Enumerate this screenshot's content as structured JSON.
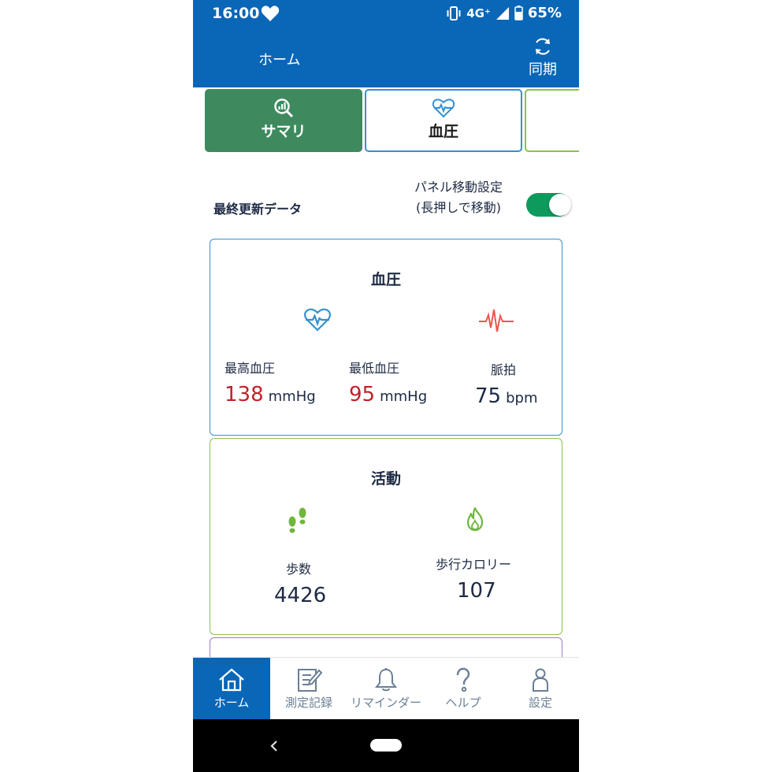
{
  "status_bar": {
    "time": "16:00",
    "network": "4G⁺",
    "battery": "65%"
  },
  "app_bar": {
    "title": "ホーム",
    "sync_label": "同期"
  },
  "tabs": [
    {
      "label": "サマリ"
    },
    {
      "label": "血圧"
    }
  ],
  "settings": {
    "last_update_label": "最終更新データ",
    "panel_move_line1": "パネル移動設定",
    "panel_move_line2": "(長押しで移動)",
    "toggle_on": true
  },
  "blood_pressure_card": {
    "title": "血圧",
    "systolic": {
      "label": "最高血圧",
      "value": "138",
      "unit": "mmHg"
    },
    "diastolic": {
      "label": "最低血圧",
      "value": "95",
      "unit": "mmHg"
    },
    "pulse": {
      "label": "脈拍",
      "value": "75",
      "unit": "bpm"
    }
  },
  "activity_card": {
    "title": "活動",
    "steps": {
      "label": "歩数",
      "value": "4426"
    },
    "calories": {
      "label": "歩行カロリー",
      "value": "107"
    }
  },
  "bottom_nav": [
    {
      "label": "ホーム",
      "active": true
    },
    {
      "label": "測定記録"
    },
    {
      "label": "リマインダー"
    },
    {
      "label": "ヘルプ"
    },
    {
      "label": "設定"
    }
  ],
  "colors": {
    "primary": "#0a66b7",
    "summary_green": "#3e8a5e",
    "bp_blue": "#3391d0",
    "activity_green": "#8bc34a",
    "alert_red": "#c0222a",
    "toggle_green": "#0e9a5c"
  }
}
